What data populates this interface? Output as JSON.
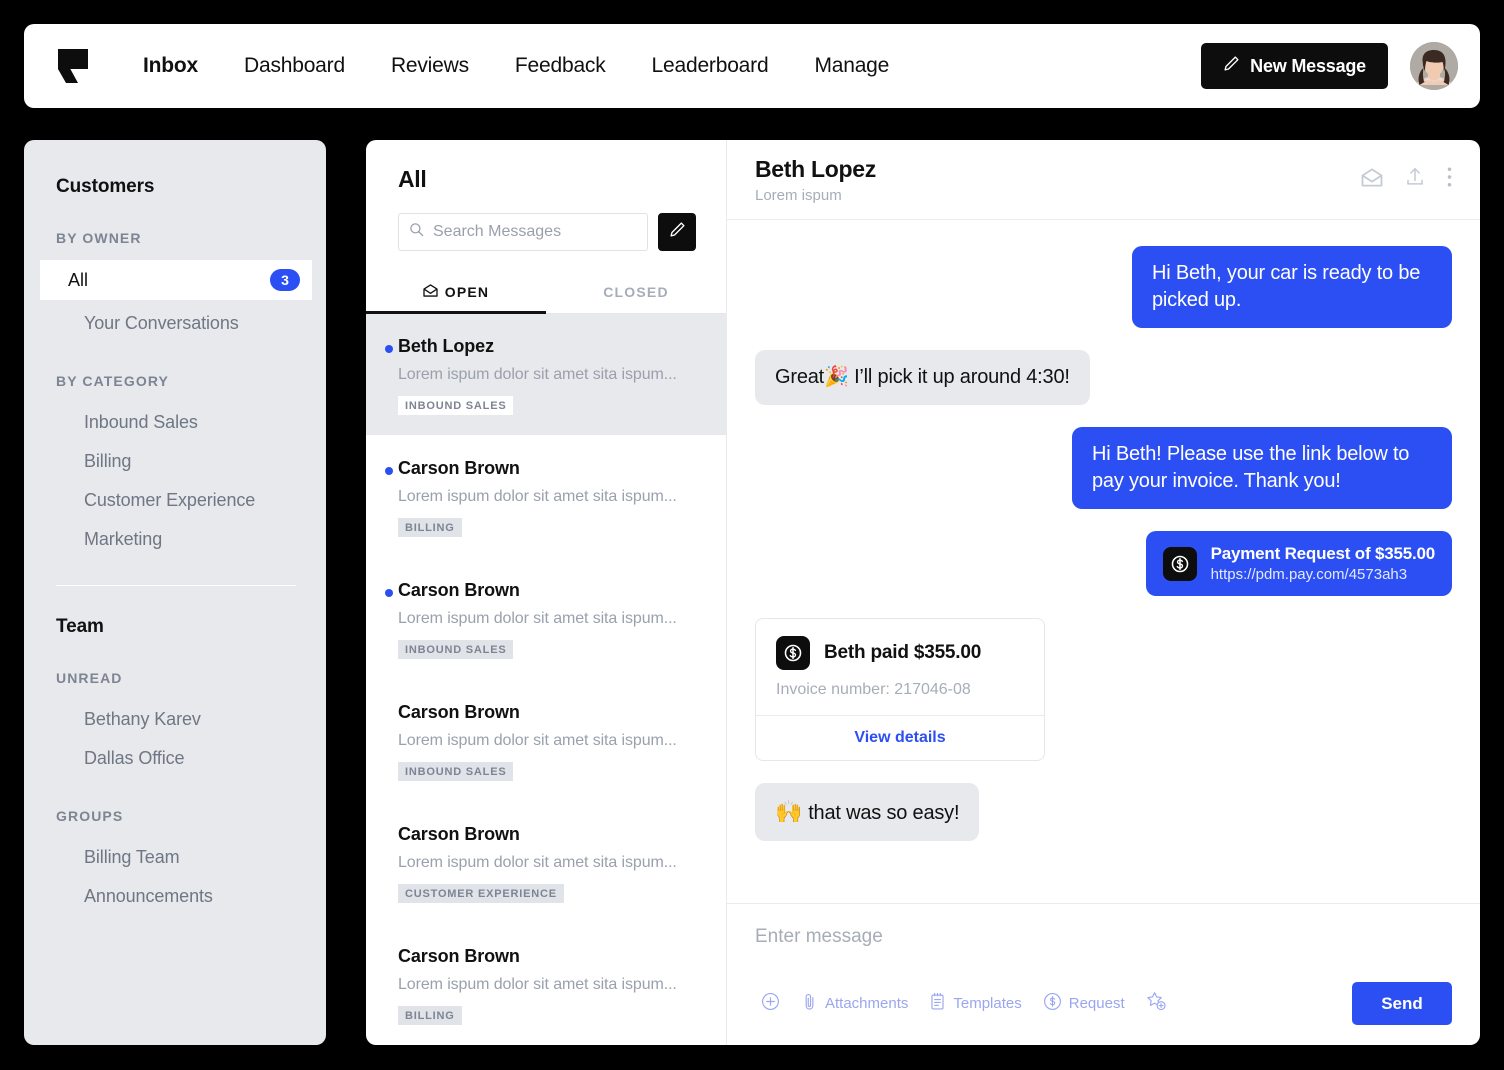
{
  "header": {
    "logo_icon": "flag-speech-bubble-logo",
    "nav_items": [
      {
        "label": "Inbox",
        "active": true
      },
      {
        "label": "Dashboard",
        "active": false
      },
      {
        "label": "Reviews",
        "active": false
      },
      {
        "label": "Feedback",
        "active": false
      },
      {
        "label": "Leaderboard",
        "active": false
      },
      {
        "label": "Manage",
        "active": false
      }
    ],
    "new_message_label": "New Message",
    "new_message_icon": "pencil-icon",
    "avatar_icon": "user-avatar-photo"
  },
  "sidebar": {
    "customers_title": "Customers",
    "by_owner_heading": "BY OWNER",
    "all_label": "All",
    "all_badge": "3",
    "your_conversations_label": "Your Conversations",
    "by_category_heading": "BY CATEGORY",
    "categories": [
      {
        "label": "Inbound Sales"
      },
      {
        "label": "Billing"
      },
      {
        "label": "Customer Experience"
      },
      {
        "label": "Marketing"
      }
    ],
    "team_title": "Team",
    "unread_heading": "UNREAD",
    "unread": [
      {
        "label": "Bethany Karev"
      },
      {
        "label": "Dallas Office"
      }
    ],
    "groups_heading": "GROUPS",
    "groups": [
      {
        "label": "Billing Team"
      },
      {
        "label": "Announcements"
      }
    ]
  },
  "list": {
    "title": "All",
    "search_placeholder": "Search Messages",
    "search_value": "",
    "search_icon": "search-icon",
    "compose_icon": "pencil-icon",
    "tabs": [
      {
        "label": "OPEN",
        "active": true,
        "icon": "open-envelope-icon"
      },
      {
        "label": "CLOSED",
        "active": false,
        "icon": ""
      }
    ],
    "conversations": [
      {
        "name": "Beth Lopez",
        "snippet": "Lorem ispum dolor sit amet sita ispum...",
        "tag": "INBOUND SALES",
        "unread": true,
        "selected": true
      },
      {
        "name": "Carson Brown",
        "snippet": "Lorem ispum dolor sit amet sita ispum...",
        "tag": "BILLING",
        "unread": true,
        "selected": false
      },
      {
        "name": "Carson Brown",
        "snippet": "Lorem ispum dolor sit amet sita ispum...",
        "tag": "INBOUND SALES",
        "unread": true,
        "selected": false
      },
      {
        "name": "Carson Brown",
        "snippet": "Lorem ispum dolor sit amet sita ispum...",
        "tag": "INBOUND SALES",
        "unread": false,
        "selected": false
      },
      {
        "name": "Carson Brown",
        "snippet": "Lorem ispum dolor sit amet sita ispum...",
        "tag": "CUSTOMER EXPERIENCE",
        "unread": false,
        "selected": false
      },
      {
        "name": "Carson Brown",
        "snippet": "Lorem ispum dolor sit amet sita ispum...",
        "tag": "BILLING",
        "unread": false,
        "selected": false
      }
    ]
  },
  "conversation": {
    "title": "Beth Lopez",
    "subtitle": "Lorem ispum",
    "header_icons": [
      "open-envelope-icon",
      "upload-icon",
      "more-vertical-icon"
    ],
    "messages": [
      {
        "side": "out",
        "text": "Hi Beth, your car is ready to be picked up."
      },
      {
        "side": "in",
        "text": "Great🎉 I’ll pick it up around 4:30!"
      },
      {
        "side": "out",
        "text": "Hi Beth! Please use the link below to pay your invoice. Thank you!"
      }
    ],
    "payment_request": {
      "icon": "dollar-circle-icon",
      "title": "Payment Request of $355.00",
      "url": "https://pdm.pay.com/4573ah3"
    },
    "payment_card": {
      "icon": "dollar-circle-icon",
      "title": "Beth paid $355.00",
      "invoice": "Invoice number: 217046-08",
      "action_label": "View details"
    },
    "last_message": {
      "emoji": "🙌",
      "text": "that was so easy!"
    }
  },
  "composer": {
    "placeholder": "Enter message",
    "value": "",
    "tools": [
      {
        "label": "",
        "icon": "plus-circle-icon"
      },
      {
        "label": "Attachments",
        "icon": "paperclip-icon"
      },
      {
        "label": "Templates",
        "icon": "notepad-icon"
      },
      {
        "label": "Request",
        "icon": "dollar-circle-icon"
      },
      {
        "label": "",
        "icon": "star-plus-icon"
      }
    ],
    "send_label": "Send"
  },
  "colors": {
    "accent_blue": "#2b4ff2",
    "background": "#000000",
    "panel_gray": "#e7e9ec",
    "muted_text": "#9aa1ad"
  }
}
